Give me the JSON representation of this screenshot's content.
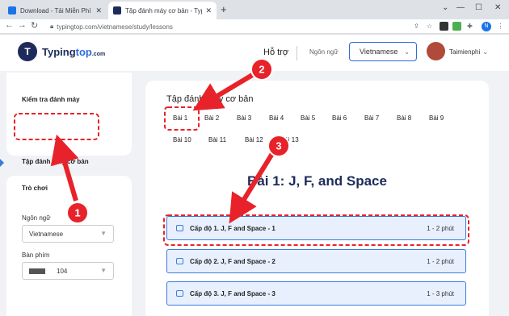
{
  "browser": {
    "tabs": [
      {
        "title": "Download - Tải Miễn Phí VN - Ph",
        "active": false,
        "favicon_color": "#1a73e8"
      },
      {
        "title": "Tập đánh máy cơ bản - TypingTo",
        "active": true,
        "favicon_color": "#1d2b5b"
      }
    ],
    "new_tab": "+",
    "url": "typingtop.com/vietnamese/study/lessons",
    "profile_letter": "N"
  },
  "site": {
    "logo_mark": "T",
    "logo_part1": "Typing",
    "logo_part2": "top",
    "logo_part3": ".com",
    "support": "Hỗ trợ",
    "language_label": "Ngôn ngữ",
    "language_value": "Vietnamese",
    "username": "Taimienphi",
    "brand_color": "#1d2b5b",
    "accent_color": "#2d6be0"
  },
  "sidebar": {
    "items": [
      {
        "label": "Kiểm tra đánh máy"
      },
      {
        "label": "Tập đánh máy cơ bản"
      },
      {
        "label": "Trò chơi"
      }
    ],
    "language_label": "Ngôn ngữ",
    "language_value": "Vietnamese",
    "keyboard_label": "Bàn phím",
    "keyboard_value": "104"
  },
  "main": {
    "title": "Tập đánh máy cơ bản",
    "lessons": [
      "Bài 1",
      "Bài 2",
      "Bài 3",
      "Bài 4",
      "Bài 5",
      "Bài 6",
      "Bài 7",
      "Bài 8",
      "Bài 9",
      "Bài 10",
      "Bài 11",
      "Bài 12",
      "Bài 13"
    ],
    "lesson_heading": "Bài 1: J, F, and Space",
    "levels": [
      {
        "name": "Cấp độ 1. J, F and Space - 1",
        "time": "1 - 2 phút"
      },
      {
        "name": "Cấp độ 2. J, F and Space - 2",
        "time": "1 - 2 phút"
      },
      {
        "name": "Cấp độ 3. J, F and Space - 3",
        "time": "1 - 3 phút"
      }
    ]
  },
  "annotations": {
    "badges": [
      "1",
      "2",
      "3"
    ],
    "color": "#e8222a"
  }
}
